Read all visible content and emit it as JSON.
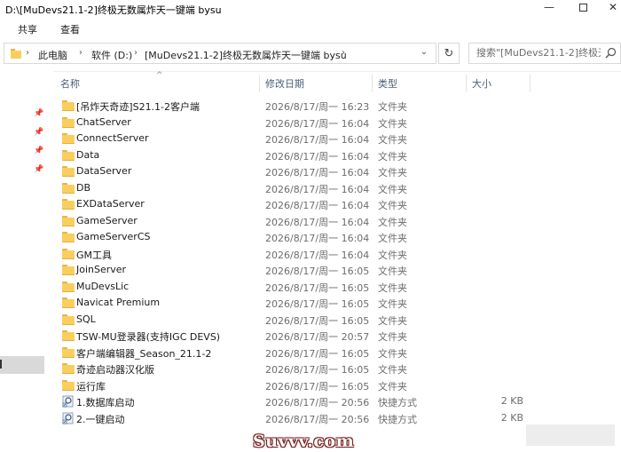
{
  "window": {
    "title": "D:\\[MuDevs21.1-2]终极无数属炸天一键端 bysu"
  },
  "ribbon": {
    "tabs": [
      "共享",
      "查看"
    ]
  },
  "address": {
    "crumbs": [
      "此电脑",
      "软件 (D:)",
      "[MuDevs21.1-2]终极无数属炸天一键端 bysu"
    ]
  },
  "search": {
    "placeholder": "搜索\"[MuDevs21.1-2]终极无..."
  },
  "columns": {
    "name": "名称",
    "date": "修改日期",
    "type": "类型",
    "size": "大小"
  },
  "files": [
    {
      "name": "[吊炸天奇迹]S21.1-2客户端",
      "date": "2026/8/17/周一 16:23",
      "type": "文件夹",
      "size": "",
      "icon": "folder-icon"
    },
    {
      "name": "ChatServer",
      "date": "2026/8/17/周一 16:04",
      "type": "文件夹",
      "size": "",
      "icon": "folder-icon"
    },
    {
      "name": "ConnectServer",
      "date": "2026/8/17/周一 16:04",
      "type": "文件夹",
      "size": "",
      "icon": "folder-icon"
    },
    {
      "name": "Data",
      "date": "2026/8/17/周一 16:04",
      "type": "文件夹",
      "size": "",
      "icon": "folder-icon"
    },
    {
      "name": "DataServer",
      "date": "2026/8/17/周一 16:04",
      "type": "文件夹",
      "size": "",
      "icon": "folder-icon"
    },
    {
      "name": "DB",
      "date": "2026/8/17/周一 16:04",
      "type": "文件夹",
      "size": "",
      "icon": "folder-icon"
    },
    {
      "name": "EXDataServer",
      "date": "2026/8/17/周一 16:04",
      "type": "文件夹",
      "size": "",
      "icon": "folder-icon"
    },
    {
      "name": "GameServer",
      "date": "2026/8/17/周一 16:04",
      "type": "文件夹",
      "size": "",
      "icon": "folder-icon"
    },
    {
      "name": "GameServerCS",
      "date": "2026/8/17/周一 16:04",
      "type": "文件夹",
      "size": "",
      "icon": "folder-icon"
    },
    {
      "name": "GM工具",
      "date": "2026/8/17/周一 16:04",
      "type": "文件夹",
      "size": "",
      "icon": "folder-icon"
    },
    {
      "name": "JoinServer",
      "date": "2026/8/17/周一 16:05",
      "type": "文件夹",
      "size": "",
      "icon": "folder-icon"
    },
    {
      "name": "MuDevsLic",
      "date": "2026/8/17/周一 16:05",
      "type": "文件夹",
      "size": "",
      "icon": "folder-icon"
    },
    {
      "name": "Navicat Premium",
      "date": "2026/8/17/周一 16:05",
      "type": "文件夹",
      "size": "",
      "icon": "folder-icon"
    },
    {
      "name": "SQL",
      "date": "2026/8/17/周一 16:05",
      "type": "文件夹",
      "size": "",
      "icon": "folder-icon"
    },
    {
      "name": "TSW-MU登录器(支持IGC DEVS)",
      "date": "2026/8/17/周一 20:57",
      "type": "文件夹",
      "size": "",
      "icon": "folder-icon"
    },
    {
      "name": "客户端编辑器_Season_21.1-2",
      "date": "2026/8/17/周一 16:05",
      "type": "文件夹",
      "size": "",
      "icon": "folder-icon"
    },
    {
      "name": "奇迹启动器汉化版",
      "date": "2026/8/17/周一 16:05",
      "type": "文件夹",
      "size": "",
      "icon": "folder-icon"
    },
    {
      "name": "运行库",
      "date": "2026/8/17/周一 16:05",
      "type": "文件夹",
      "size": "",
      "icon": "folder-icon"
    },
    {
      "name": "1.数据库启动",
      "date": "2026/8/17/周一 20:56",
      "type": "快捷方式",
      "size": "2 KB",
      "icon": "shortcut-icon"
    },
    {
      "name": "2.一键启动",
      "date": "2026/8/17/周一 20:56",
      "type": "快捷方式",
      "size": "2 KB",
      "icon": "shortcut-icon"
    }
  ],
  "watermark": {
    "text": "Suvvv.com"
  },
  "colors": {
    "folder": "#f8cf5f",
    "header_text": "#4c607a",
    "secondary_text": "#6d6d6d",
    "selection": "#d9d9d9"
  }
}
